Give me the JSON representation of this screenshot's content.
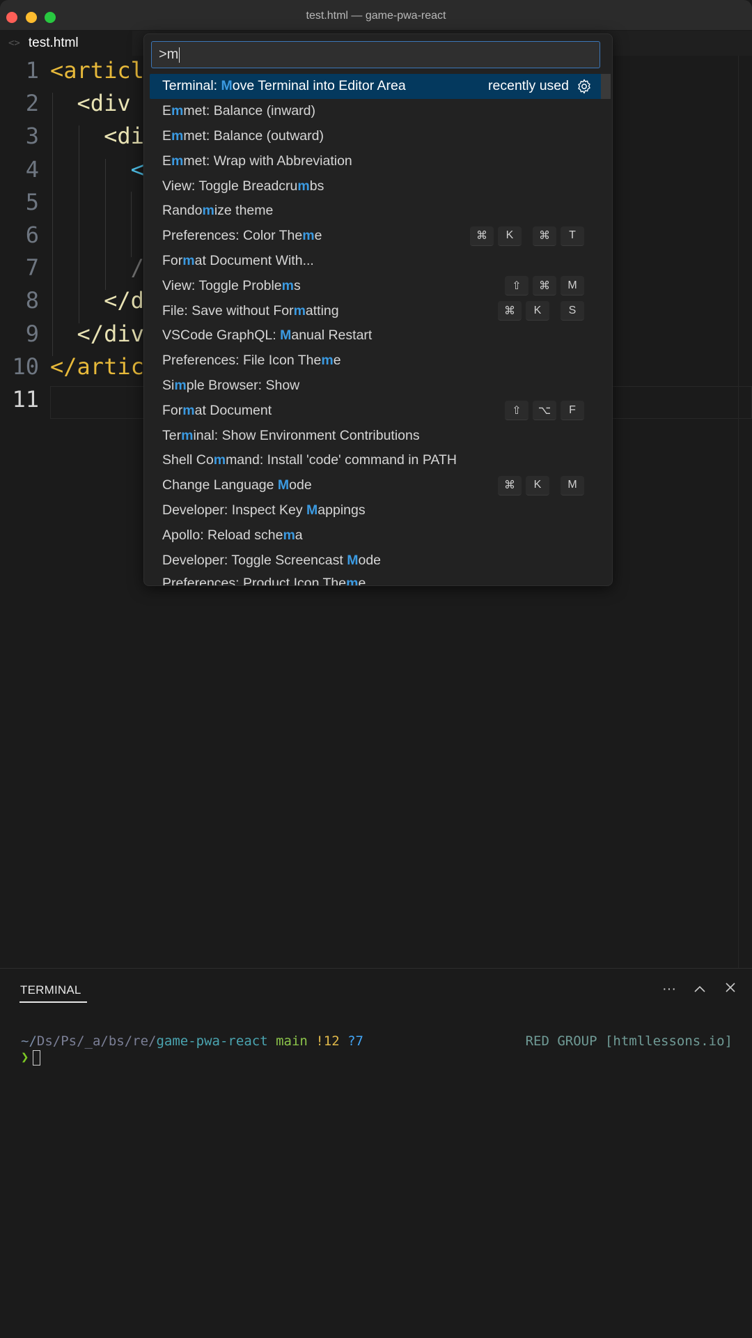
{
  "window": {
    "title": "test.html — game-pwa-react"
  },
  "tabs": [
    {
      "label": "test.html",
      "icon": "code-icon"
    }
  ],
  "editor": {
    "lines": [
      {
        "number": "1",
        "code": "<articl"
      },
      {
        "number": "2",
        "code": "  <div "
      },
      {
        "number": "3",
        "code": "    <di"
      },
      {
        "number": "4",
        "code": "      <"
      },
      {
        "number": "5",
        "code": ""
      },
      {
        "number": "6",
        "code": ""
      },
      {
        "number": "7",
        "code": "      /"
      },
      {
        "number": "8",
        "code": "    </d"
      },
      {
        "number": "9",
        "code": "  </div"
      },
      {
        "number": "10",
        "code": "</artic"
      },
      {
        "number": "11",
        "code": ""
      }
    ]
  },
  "command_palette": {
    "input_value": ">m",
    "items": [
      {
        "pre": "Terminal: ",
        "hl": "M",
        "post": "ove Terminal into Editor Area",
        "right_label": "recently used",
        "icon": "gear-icon",
        "selected": true,
        "keys": []
      },
      {
        "pre": "E",
        "hl": "m",
        "post": "met: Balance (inward)",
        "keys": []
      },
      {
        "pre": "E",
        "hl": "m",
        "post": "met: Balance (outward)",
        "keys": []
      },
      {
        "pre": "E",
        "hl": "m",
        "post": "met: Wrap with Abbreviation",
        "keys": []
      },
      {
        "pre": "View: Toggle Breadcru",
        "hl": "m",
        "post": "bs",
        "keys": []
      },
      {
        "pre": "Rando",
        "hl": "m",
        "post": "ize theme",
        "keys": []
      },
      {
        "pre": "Preferences: Color The",
        "hl": "m",
        "post": "e",
        "keys": [
          "⌘",
          "K",
          "⌘",
          "T"
        ]
      },
      {
        "pre": "For",
        "hl": "m",
        "post": "at Document With...",
        "keys": []
      },
      {
        "pre": "View: Toggle Proble",
        "hl": "m",
        "post": "s",
        "keys": [
          "⇧",
          "⌘",
          "M"
        ]
      },
      {
        "pre": "File: Save without For",
        "hl": "m",
        "post": "atting",
        "keys": [
          "⌘",
          "K",
          "S"
        ]
      },
      {
        "pre": "VSCode GraphQL: ",
        "hl": "M",
        "post": "anual Restart",
        "keys": []
      },
      {
        "pre": "Preferences: File Icon The",
        "hl": "m",
        "post": "e",
        "keys": []
      },
      {
        "pre": "Si",
        "hl": "m",
        "post": "ple Browser: Show",
        "keys": []
      },
      {
        "pre": "For",
        "hl": "m",
        "post": "at Document",
        "keys": [
          "⇧",
          "⌥",
          "F"
        ]
      },
      {
        "pre": "Ter",
        "hl": "m",
        "post": "inal: Show Environment Contributions",
        "keys": []
      },
      {
        "pre": "Shell Co",
        "hl": "m",
        "post": "mand: Install 'code' command in PATH",
        "keys": []
      },
      {
        "pre": "Change Language ",
        "hl": "M",
        "post": "ode",
        "keys": [
          "⌘",
          "K",
          "M"
        ]
      },
      {
        "pre": "Developer: Inspect Key ",
        "hl": "M",
        "post": "appings",
        "keys": []
      },
      {
        "pre": "Apollo: Reload sche",
        "hl": "m",
        "post": "a",
        "keys": []
      },
      {
        "pre": "Developer: Toggle Screencast ",
        "hl": "M",
        "post": "ode",
        "keys": []
      },
      {
        "pre": "Preferences: Product Icon The",
        "hl": "m",
        "post": "e",
        "keys": [],
        "partial": true
      }
    ]
  },
  "panel": {
    "tab_label": "TERMINAL",
    "actions": [
      "more-icon",
      "maximize-icon",
      "close-icon"
    ],
    "terminal": {
      "path_tilde": "~/",
      "path_dim": "Ds/Ps/_a/bs/re/",
      "path_dir": "game-pwa-react",
      "branch": "main",
      "modified": "!12",
      "untracked": "?7",
      "right_prompt": "RED GROUP [htmllessons.io]",
      "prompt_symbol": "❯"
    }
  },
  "colors": {
    "accent": "#3b9ae1",
    "selection": "#04395e",
    "input_border": "#3c77b8"
  }
}
